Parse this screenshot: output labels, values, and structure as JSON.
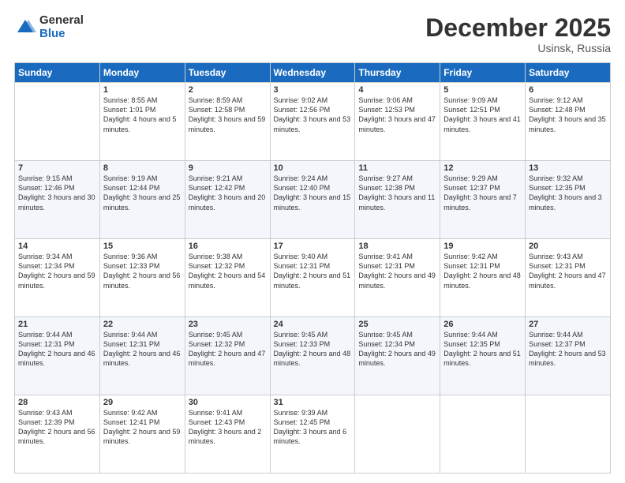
{
  "logo": {
    "general": "General",
    "blue": "Blue"
  },
  "header": {
    "month": "December 2025",
    "location": "Usinsk, Russia"
  },
  "days": [
    "Sunday",
    "Monday",
    "Tuesday",
    "Wednesday",
    "Thursday",
    "Friday",
    "Saturday"
  ],
  "weeks": [
    [
      {
        "day": "",
        "sunrise": "",
        "sunset": "",
        "daylight": ""
      },
      {
        "day": "1",
        "sunrise": "Sunrise: 8:55 AM",
        "sunset": "Sunset: 1:01 PM",
        "daylight": "Daylight: 4 hours and 5 minutes."
      },
      {
        "day": "2",
        "sunrise": "Sunrise: 8:59 AM",
        "sunset": "Sunset: 12:58 PM",
        "daylight": "Daylight: 3 hours and 59 minutes."
      },
      {
        "day": "3",
        "sunrise": "Sunrise: 9:02 AM",
        "sunset": "Sunset: 12:56 PM",
        "daylight": "Daylight: 3 hours and 53 minutes."
      },
      {
        "day": "4",
        "sunrise": "Sunrise: 9:06 AM",
        "sunset": "Sunset: 12:53 PM",
        "daylight": "Daylight: 3 hours and 47 minutes."
      },
      {
        "day": "5",
        "sunrise": "Sunrise: 9:09 AM",
        "sunset": "Sunset: 12:51 PM",
        "daylight": "Daylight: 3 hours and 41 minutes."
      },
      {
        "day": "6",
        "sunrise": "Sunrise: 9:12 AM",
        "sunset": "Sunset: 12:48 PM",
        "daylight": "Daylight: 3 hours and 35 minutes."
      }
    ],
    [
      {
        "day": "7",
        "sunrise": "Sunrise: 9:15 AM",
        "sunset": "Sunset: 12:46 PM",
        "daylight": "Daylight: 3 hours and 30 minutes."
      },
      {
        "day": "8",
        "sunrise": "Sunrise: 9:19 AM",
        "sunset": "Sunset: 12:44 PM",
        "daylight": "Daylight: 3 hours and 25 minutes."
      },
      {
        "day": "9",
        "sunrise": "Sunrise: 9:21 AM",
        "sunset": "Sunset: 12:42 PM",
        "daylight": "Daylight: 3 hours and 20 minutes."
      },
      {
        "day": "10",
        "sunrise": "Sunrise: 9:24 AM",
        "sunset": "Sunset: 12:40 PM",
        "daylight": "Daylight: 3 hours and 15 minutes."
      },
      {
        "day": "11",
        "sunrise": "Sunrise: 9:27 AM",
        "sunset": "Sunset: 12:38 PM",
        "daylight": "Daylight: 3 hours and 11 minutes."
      },
      {
        "day": "12",
        "sunrise": "Sunrise: 9:29 AM",
        "sunset": "Sunset: 12:37 PM",
        "daylight": "Daylight: 3 hours and 7 minutes."
      },
      {
        "day": "13",
        "sunrise": "Sunrise: 9:32 AM",
        "sunset": "Sunset: 12:35 PM",
        "daylight": "Daylight: 3 hours and 3 minutes."
      }
    ],
    [
      {
        "day": "14",
        "sunrise": "Sunrise: 9:34 AM",
        "sunset": "Sunset: 12:34 PM",
        "daylight": "Daylight: 2 hours and 59 minutes."
      },
      {
        "day": "15",
        "sunrise": "Sunrise: 9:36 AM",
        "sunset": "Sunset: 12:33 PM",
        "daylight": "Daylight: 2 hours and 56 minutes."
      },
      {
        "day": "16",
        "sunrise": "Sunrise: 9:38 AM",
        "sunset": "Sunset: 12:32 PM",
        "daylight": "Daylight: 2 hours and 54 minutes."
      },
      {
        "day": "17",
        "sunrise": "Sunrise: 9:40 AM",
        "sunset": "Sunset: 12:31 PM",
        "daylight": "Daylight: 2 hours and 51 minutes."
      },
      {
        "day": "18",
        "sunrise": "Sunrise: 9:41 AM",
        "sunset": "Sunset: 12:31 PM",
        "daylight": "Daylight: 2 hours and 49 minutes."
      },
      {
        "day": "19",
        "sunrise": "Sunrise: 9:42 AM",
        "sunset": "Sunset: 12:31 PM",
        "daylight": "Daylight: 2 hours and 48 minutes."
      },
      {
        "day": "20",
        "sunrise": "Sunrise: 9:43 AM",
        "sunset": "Sunset: 12:31 PM",
        "daylight": "Daylight: 2 hours and 47 minutes."
      }
    ],
    [
      {
        "day": "21",
        "sunrise": "Sunrise: 9:44 AM",
        "sunset": "Sunset: 12:31 PM",
        "daylight": "Daylight: 2 hours and 46 minutes."
      },
      {
        "day": "22",
        "sunrise": "Sunrise: 9:44 AM",
        "sunset": "Sunset: 12:31 PM",
        "daylight": "Daylight: 2 hours and 46 minutes."
      },
      {
        "day": "23",
        "sunrise": "Sunrise: 9:45 AM",
        "sunset": "Sunset: 12:32 PM",
        "daylight": "Daylight: 2 hours and 47 minutes."
      },
      {
        "day": "24",
        "sunrise": "Sunrise: 9:45 AM",
        "sunset": "Sunset: 12:33 PM",
        "daylight": "Daylight: 2 hours and 48 minutes."
      },
      {
        "day": "25",
        "sunrise": "Sunrise: 9:45 AM",
        "sunset": "Sunset: 12:34 PM",
        "daylight": "Daylight: 2 hours and 49 minutes."
      },
      {
        "day": "26",
        "sunrise": "Sunrise: 9:44 AM",
        "sunset": "Sunset: 12:35 PM",
        "daylight": "Daylight: 2 hours and 51 minutes."
      },
      {
        "day": "27",
        "sunrise": "Sunrise: 9:44 AM",
        "sunset": "Sunset: 12:37 PM",
        "daylight": "Daylight: 2 hours and 53 minutes."
      }
    ],
    [
      {
        "day": "28",
        "sunrise": "Sunrise: 9:43 AM",
        "sunset": "Sunset: 12:39 PM",
        "daylight": "Daylight: 2 hours and 56 minutes."
      },
      {
        "day": "29",
        "sunrise": "Sunrise: 9:42 AM",
        "sunset": "Sunset: 12:41 PM",
        "daylight": "Daylight: 2 hours and 59 minutes."
      },
      {
        "day": "30",
        "sunrise": "Sunrise: 9:41 AM",
        "sunset": "Sunset: 12:43 PM",
        "daylight": "Daylight: 3 hours and 2 minutes."
      },
      {
        "day": "31",
        "sunrise": "Sunrise: 9:39 AM",
        "sunset": "Sunset: 12:45 PM",
        "daylight": "Daylight: 3 hours and 6 minutes."
      },
      {
        "day": "",
        "sunrise": "",
        "sunset": "",
        "daylight": ""
      },
      {
        "day": "",
        "sunrise": "",
        "sunset": "",
        "daylight": ""
      },
      {
        "day": "",
        "sunrise": "",
        "sunset": "",
        "daylight": ""
      }
    ]
  ]
}
